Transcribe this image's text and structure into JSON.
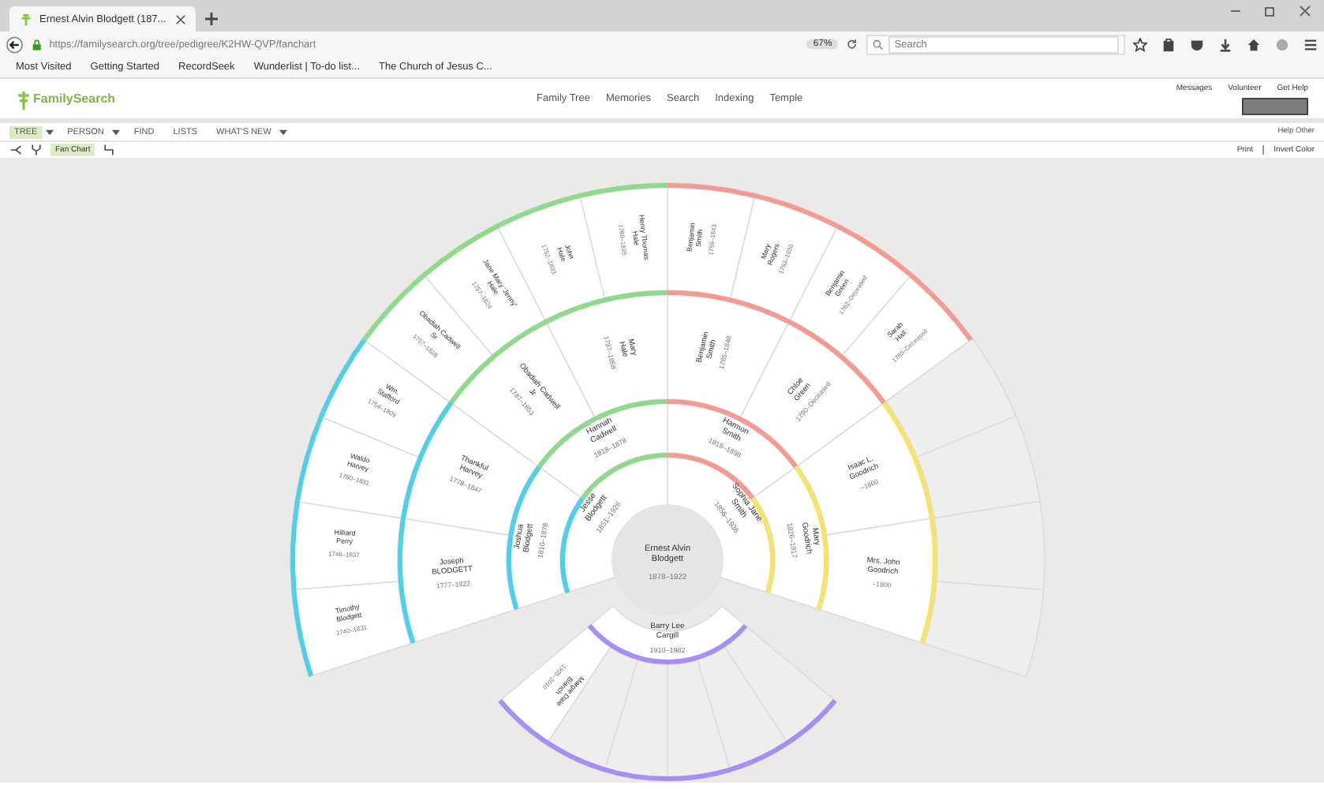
{
  "browser": {
    "tab_title": "Ernest Alvin Blodgett (187...",
    "url": "https://familysearch.org/tree/pedigree/K2HW-QVP/fanchart",
    "zoom": "67%",
    "search_placeholder": "Search",
    "bookmarks": [
      "Most Visited",
      "Getting Started",
      "RecordSeek",
      "Wunderlist | To-do list...",
      "The Church of Jesus C..."
    ]
  },
  "site": {
    "logo": "FamilySearch",
    "nav": [
      "Family Tree",
      "Memories",
      "Search",
      "Indexing",
      "Temple"
    ],
    "top_links": [
      "Messages",
      "Volunteer",
      "Get Help"
    ],
    "help_others": "Help Other"
  },
  "toolbar": {
    "menus": [
      {
        "label": "TREE",
        "selected": true,
        "dropdown": true
      },
      {
        "label": "PERSON",
        "selected": false,
        "dropdown": true
      },
      {
        "label": "FIND",
        "selected": false,
        "dropdown": false
      },
      {
        "label": "LISTS",
        "selected": false,
        "dropdown": false
      },
      {
        "label": "WHAT'S NEW",
        "selected": false,
        "dropdown": true
      }
    ],
    "views": [
      {
        "kind": "landscape",
        "selected": false
      },
      {
        "kind": "portrait",
        "selected": false
      },
      {
        "kind": "fan",
        "label": "Fan Chart",
        "selected": true
      },
      {
        "kind": "descendancy",
        "selected": false
      }
    ],
    "print": "Print",
    "invert": "Invert Color"
  },
  "fan_chart": {
    "root": {
      "name": "Ernest Alvin Blodgett",
      "dates": "1878–1922",
      "parents": [
        {
          "name": "Jesse Blodgett",
          "dates": "1851–1926",
          "parents": [
            {
              "name": "Joshua Blodgett",
              "dates": "1810–1878",
              "color": "#4fcfea",
              "parents": [
                {
                  "name": "Joseph BLODGETT",
                  "dates": "1777–1822",
                  "parents": [
                    {
                      "name": "Timothy Blodgett",
                      "dates": "1740–1831"
                    },
                    {
                      "name": "Hilliard Perry",
                      "dates": "1748–1837"
                    }
                  ]
                },
                {
                  "name": "Thankful Harvey",
                  "dates": "1778–1847",
                  "parents": [
                    {
                      "name": "Waldo Harvey",
                      "dates": "1750–1831"
                    },
                    {
                      "name": "Wm. Stafford",
                      "dates": "1754–1809"
                    }
                  ]
                }
              ]
            },
            {
              "name": "Hannah Cadwell",
              "dates": "1818–1878",
              "color": "#8fd98a",
              "parents": [
                {
                  "name": "Obadiah Cadwell Jr",
                  "dates": "1787–1853",
                  "parents": [
                    {
                      "name": "Obadiah Cadwell Sr",
                      "dates": "1757–1828"
                    },
                    {
                      "name": "Jane Mary 'Jenny' Hale",
                      "dates": "1757–1824"
                    }
                  ]
                },
                {
                  "name": "Mary Hale",
                  "dates": "1787–1858",
                  "parents": [
                    {
                      "name": "John Hale",
                      "dates": "1752–1833"
                    },
                    {
                      "name": "Henry Thomas Hale",
                      "dates": "1760–1835"
                    }
                  ]
                }
              ]
            }
          ]
        },
        {
          "name": "Sophia Jane Smith",
          "dates": "1856–1936",
          "parents": [
            {
              "name": "Harmon Smith",
              "dates": "1818–1898",
              "color": "#f59a93",
              "parents": [
                {
                  "name": "Benjamin Smith",
                  "dates": "1785–1848",
                  "parents": [
                    {
                      "name": "Benjamin Smith",
                      "dates": "1759–1843"
                    },
                    {
                      "name": "Mary Rogers",
                      "dates": "1763–1830"
                    }
                  ]
                },
                {
                  "name": "Chloe Green",
                  "dates": "1790–Deceased",
                  "parents": [
                    {
                      "name": "Benjamin Green",
                      "dates": "1762–Deceased"
                    },
                    {
                      "name": "Sarah Hall",
                      "dates": "1765–Deceased"
                    }
                  ]
                }
              ]
            },
            {
              "name": "Mary Goodrich",
              "dates": "1826–1917",
              "color": "#f5e36e",
              "parents": [
                {
                  "name": "Isaac L. Goodrich",
                  "dates": "~1800"
                },
                {
                  "name": "Mrs. John Goodrich",
                  "dates": "~1800"
                }
              ]
            }
          ]
        }
      ]
    },
    "descendants": {
      "color": "#a68ef2",
      "children": [
        {
          "name": "Barry Lee Cargill",
          "dates": "1910–1982",
          "children": [
            {
              "name": "Margie Dale Blanch",
              "dates": "1935–2010"
            }
          ]
        }
      ]
    }
  }
}
